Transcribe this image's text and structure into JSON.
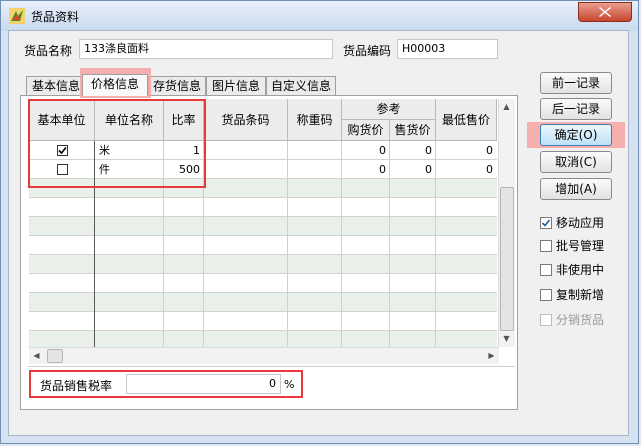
{
  "window": {
    "title": "货品资料",
    "accent": "#e53b3b"
  },
  "form": {
    "name_label": "货品名称",
    "name_value": "133涤良面料",
    "code_label": "货品编码",
    "code_value": "H00003"
  },
  "tabs": [
    {
      "label": "基本信息",
      "active": false
    },
    {
      "label": "价格信息",
      "active": true
    },
    {
      "label": "存货信息",
      "active": false
    },
    {
      "label": "图片信息",
      "active": false
    },
    {
      "label": "自定义信息",
      "active": false
    }
  ],
  "grid": {
    "headers": {
      "base_unit": "基本单位",
      "unit_name": "单位名称",
      "ratio": "比率",
      "barcode": "货品条码",
      "weigh_code": "称重码",
      "ref": "参考",
      "purchase_price": "购货价",
      "sale_price": "售货价",
      "min_price": "最低售价"
    },
    "rows": [
      {
        "base_unit_checked": true,
        "unit_name": "米",
        "ratio": "1",
        "purchase_price": "0",
        "sale_price": "0",
        "min_price": "0"
      },
      {
        "base_unit_checked": false,
        "unit_name": "件",
        "ratio": "500",
        "purchase_price": "0",
        "sale_price": "0",
        "min_price": "0"
      }
    ]
  },
  "tax": {
    "label": "货品销售税率",
    "value": "0",
    "unit": "%"
  },
  "buttons": {
    "prev": "前一记录",
    "next": "后一记录",
    "ok": "确定(O)",
    "cancel": "取消(C)",
    "add": "增加(A)"
  },
  "options": [
    {
      "label": "移动应用",
      "checked": true,
      "disabled": false
    },
    {
      "label": "批号管理",
      "checked": false,
      "disabled": false
    },
    {
      "label": "非使用中",
      "checked": false,
      "disabled": false
    },
    {
      "label": "复制新增",
      "checked": false,
      "disabled": false
    },
    {
      "label": "分销货品",
      "checked": false,
      "disabled": true
    }
  ],
  "icons": {
    "close": "close-icon",
    "app": "app-icon",
    "check": "check-icon"
  }
}
